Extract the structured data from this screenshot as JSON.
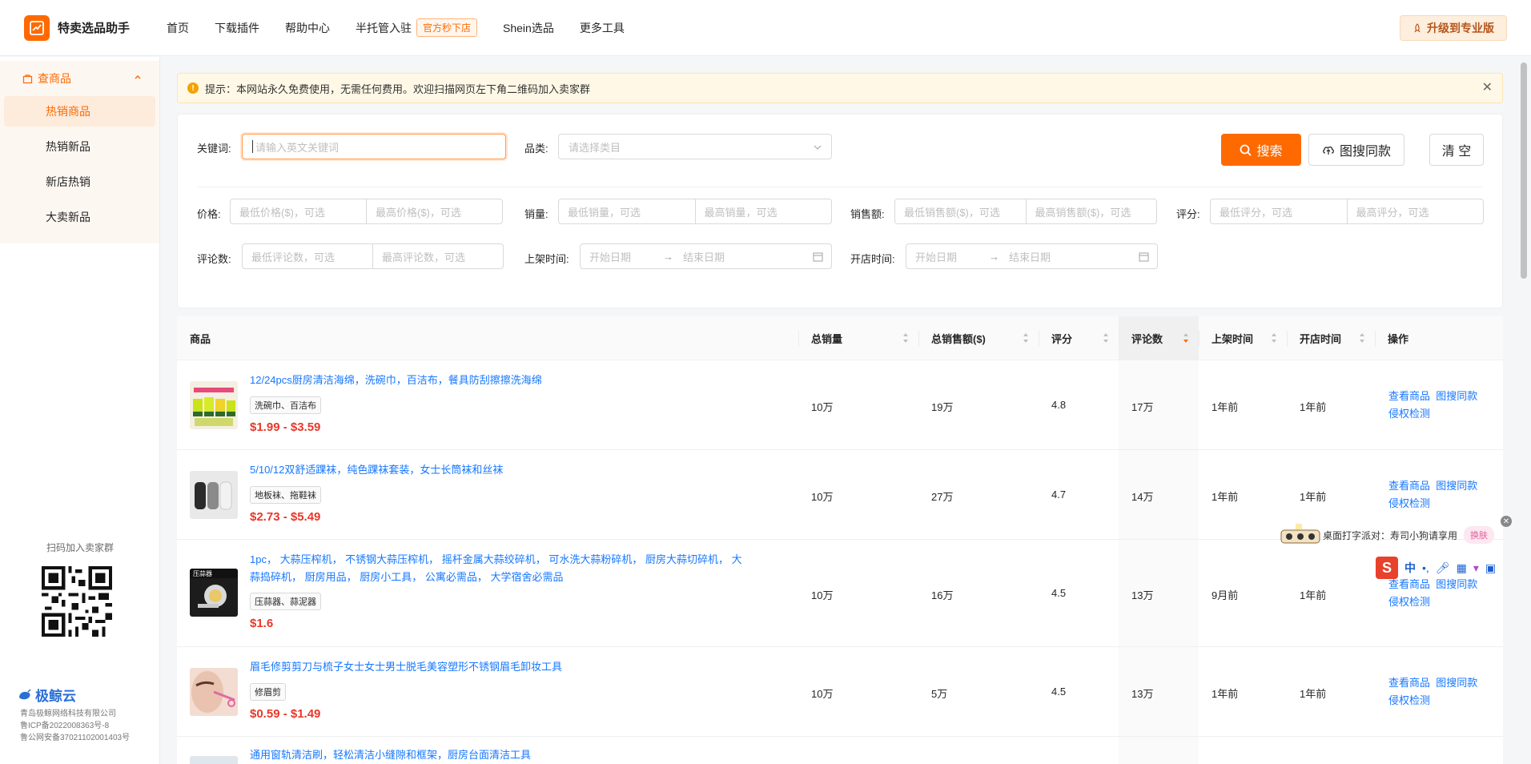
{
  "app": {
    "name": "特卖选品助手"
  },
  "nav": [
    {
      "label": "首页"
    },
    {
      "label": "下载插件"
    },
    {
      "label": "帮助中心"
    },
    {
      "label": "半托管入驻",
      "badge": "官方秒下店"
    },
    {
      "label": "Shein选品"
    },
    {
      "label": "更多工具"
    }
  ],
  "upgrade_label": "升级到专业版",
  "sidebar": {
    "group_label": "查商品",
    "items": [
      {
        "label": "热销商品",
        "active": true
      },
      {
        "label": "热销新品"
      },
      {
        "label": "新店热销"
      },
      {
        "label": "大卖新品"
      }
    ],
    "qr_title": "扫码加入卖家群",
    "company_name": "极鲸云",
    "company_lines": [
      "青岛极鲸网络科技有限公司",
      "鲁ICP备2022008363号-8",
      "鲁公网安备37021102001403号"
    ]
  },
  "notice": {
    "text": "提示：本网站永久免费使用，无需任何费用。欢迎扫描网页左下角二维码加入卖家群"
  },
  "filters": {
    "keyword_label": "关键词:",
    "keyword_placeholder": "请输入英文关键词",
    "category_label": "品类:",
    "category_placeholder": "请选择类目",
    "search_label": "搜索",
    "image_search_label": "图搜同款",
    "clear_label": "清 空",
    "price_label": "价格:",
    "price_min": "最低价格($)，可选",
    "price_max": "最高价格($)，可选",
    "sales_label": "销量:",
    "sales_min": "最低销量，可选",
    "sales_max": "最高销量，可选",
    "revenue_label": "销售额:",
    "revenue_min": "最低销售额($)，可选",
    "revenue_max": "最高销售额($)，可选",
    "rating_label": "评分:",
    "rating_min": "最低评分，可选",
    "rating_max": "最高评分，可选",
    "reviews_label": "评论数:",
    "reviews_min": "最低评论数，可选",
    "reviews_max": "最高评论数，可选",
    "listed_label": "上架时间:",
    "open_label": "开店时间:",
    "date_start": "开始日期",
    "date_end": "结束日期"
  },
  "table": {
    "headers": [
      "商品",
      "总销量",
      "总销售额($)",
      "评分",
      "评论数",
      "上架时间",
      "开店时间",
      "操作"
    ],
    "actions": {
      "view": "查看商品",
      "image_search": "图搜同款",
      "infringe": "侵权检测"
    },
    "rows": [
      {
        "title_lines": [
          "12/24pcs厨房清洁海绵，洗碗巾，百洁布，餐具防刮擦擦洗海绵"
        ],
        "tag": "洗碗巾、百洁布",
        "price": "$1.99 - $3.59",
        "sales": "10万",
        "revenue": "19万",
        "rating": "4.8",
        "reviews": "17万",
        "listed": "1年前",
        "opened": "1年前"
      },
      {
        "title_lines": [
          "5/10/12双舒适踝袜，纯色踝袜套装，女士长筒袜和丝袜"
        ],
        "tag": "地板袜、拖鞋袜",
        "price": "$2.73 - $5.49",
        "sales": "10万",
        "revenue": "27万",
        "rating": "4.7",
        "reviews": "14万",
        "listed": "1年前",
        "opened": "1年前"
      },
      {
        "title_lines": [
          "1pc， 大蒜压榨机， 不锈钢大蒜压榨机， 摇杆金属大蒜绞碎机， 可水洗大蒜粉碎机， 厨房大蒜切碎机， 大",
          "蒜捣碎机， 厨房用品， 厨房小工具， 公寓必需品， 大学宿舍必需品"
        ],
        "tag": "压蒜器、蒜泥器",
        "price": "$1.6",
        "sales": "10万",
        "revenue": "16万",
        "rating": "4.5",
        "reviews": "13万",
        "listed": "9月前",
        "opened": "1年前"
      },
      {
        "title_lines": [
          "眉毛修剪剪刀与梳子女士女士男士脱毛美容塑形不锈钢眉毛卸妆工具"
        ],
        "tag": "修眉剪",
        "price": "$0.59 - $1.49",
        "sales": "10万",
        "revenue": "5万",
        "rating": "4.5",
        "reviews": "13万",
        "listed": "1年前",
        "opened": "1年前"
      },
      {
        "title_lines": [
          "通用窗轨清洁刷，轻松清洁小缝隙和框架，厨房台面清洁工具"
        ]
      }
    ]
  },
  "ime": {
    "text": "桌面打字派对：寿司小狗请享用",
    "skin": "换肤",
    "cn": "中"
  },
  "colors": {
    "accent": "#ff6a00",
    "link": "#1677ff",
    "price": "#e8382a"
  }
}
